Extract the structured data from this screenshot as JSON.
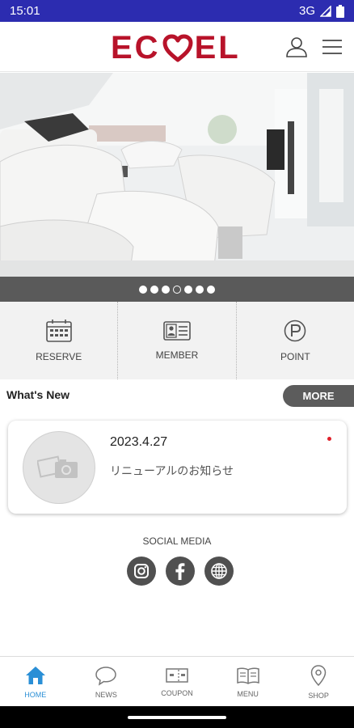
{
  "status": {
    "time": "15:01",
    "network": "3G"
  },
  "header": {
    "logo_left": "EC",
    "logo_right": "EL"
  },
  "slider": {
    "count": 7,
    "active_index": 3
  },
  "quick_menu": [
    {
      "label": "RESERVE",
      "icon": "calendar-icon"
    },
    {
      "label": "MEMBER",
      "icon": "member-card-icon"
    },
    {
      "label": "POINT",
      "icon": "point-icon"
    }
  ],
  "whats_new": {
    "title": "What's New",
    "more_label": "MORE",
    "items": [
      {
        "date": "2023.4.27",
        "text": "リニューアルのお知らせ"
      }
    ]
  },
  "social": {
    "title": "SOCIAL MEDIA",
    "links": [
      "instagram-icon",
      "facebook-icon",
      "globe-icon"
    ]
  },
  "bottom_nav": [
    {
      "label": "HOME",
      "icon": "home-icon",
      "active": true
    },
    {
      "label": "NEWS",
      "icon": "chat-bubble-icon",
      "active": false
    },
    {
      "label": "COUPON",
      "icon": "ticket-icon",
      "active": false
    },
    {
      "label": "MENU",
      "icon": "book-icon",
      "active": false
    },
    {
      "label": "SHOP",
      "icon": "location-pin-icon",
      "active": false
    }
  ],
  "colors": {
    "brand": "#b8132a",
    "status_bar": "#2c2cb0",
    "nav_active": "#2a8fd6"
  }
}
